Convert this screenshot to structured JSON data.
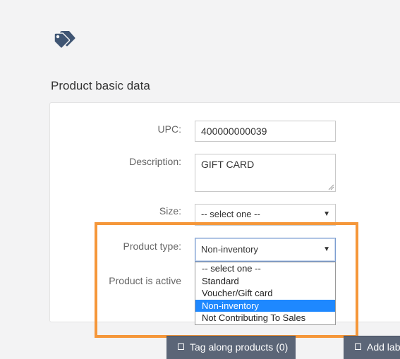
{
  "page": {
    "icon": "tag-icon",
    "section_title": "Product basic data"
  },
  "form": {
    "upc": {
      "label": "UPC:",
      "value": "400000000039"
    },
    "description": {
      "label": "Description:",
      "value": "GIFT CARD"
    },
    "size": {
      "label": "Size:",
      "value": "-- select one --"
    },
    "product_type": {
      "label": "Product type:",
      "value": "Non-inventory",
      "options": [
        "-- select one --",
        "Standard",
        "Voucher/Gift card",
        "Non-inventory",
        "Not Contributing To Sales"
      ],
      "selected_index": 3
    },
    "active": {
      "label": "Product is active"
    }
  },
  "buttons": {
    "tag_along": "Tag along products (0)",
    "add_label": "Add lab"
  },
  "colors": {
    "highlight": "#f5973a",
    "selected_option": "#1e88ff",
    "button_bg": "#5b6577",
    "icon": "#3f5573"
  }
}
